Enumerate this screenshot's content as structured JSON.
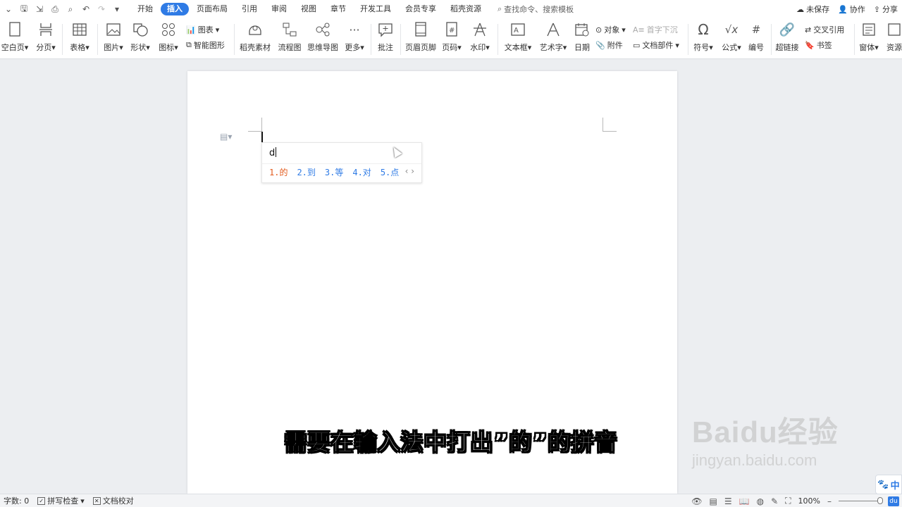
{
  "menubar": {
    "tabs": [
      {
        "label": "开始",
        "active": false
      },
      {
        "label": "插入",
        "active": true
      },
      {
        "label": "页面布局",
        "active": false
      },
      {
        "label": "引用",
        "active": false
      },
      {
        "label": "审阅",
        "active": false
      },
      {
        "label": "视图",
        "active": false
      },
      {
        "label": "章节",
        "active": false
      },
      {
        "label": "开发工具",
        "active": false
      },
      {
        "label": "会员专享",
        "active": false
      },
      {
        "label": "稻壳资源",
        "active": false
      }
    ],
    "search_label": "查找命令、搜索模板",
    "unsaved": "未保存",
    "collab": "协作",
    "share": "分享"
  },
  "ribbon": {
    "blank_page": "空白页",
    "page_break": "分页",
    "table": "表格",
    "picture": "图片",
    "shape": "形状",
    "icon": "图标",
    "chart": "图表",
    "smart_shape": "智能图形",
    "docer_material": "稻壳素材",
    "flowchart": "流程图",
    "mindmap": "思维导图",
    "more": "更多",
    "comment": "批注",
    "header_footer": "页眉页脚",
    "page_number": "页码",
    "watermark": "水印",
    "textbox": "文本框",
    "wordart": "艺术字",
    "date": "日期",
    "object": "对象",
    "attachment": "附件",
    "dropcap": "首字下沉",
    "doc_parts": "文档部件",
    "symbol": "符号",
    "formula": "公式",
    "numbering": "编号",
    "hyperlink": "超链接",
    "cross_ref": "交叉引用",
    "bookmark": "书签",
    "window": "窗体",
    "resource": "资源"
  },
  "ime": {
    "input": "d",
    "candidates": [
      "1.的",
      "2.到",
      "3.等",
      "4.对",
      "5.点"
    ],
    "nav": "‹ ›"
  },
  "subtitle": "需要在输入法中打出”的”的拼音",
  "watermark": {
    "brand": "Baidu经验",
    "url": "jingyan.baidu.com"
  },
  "statusbar": {
    "word_count": "字数: 0",
    "spell_check": "拼写检查",
    "doc_proof": "文档校对",
    "zoom": "100%",
    "ime_label": "中"
  },
  "colors": {
    "accent": "#2f7be5",
    "candidate_first": "#e25a1c"
  }
}
